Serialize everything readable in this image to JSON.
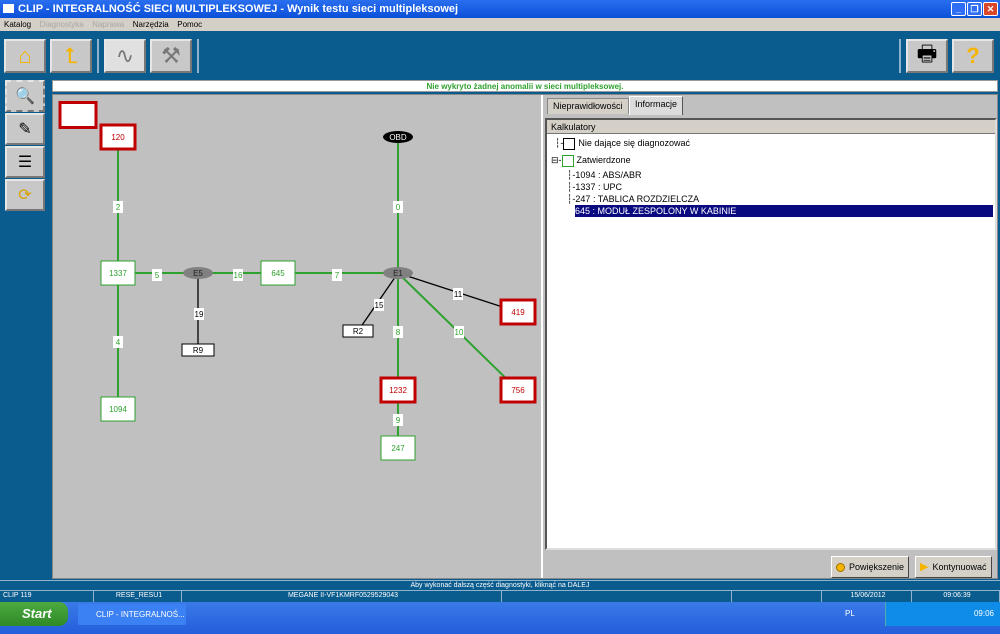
{
  "window": {
    "title": "CLIP - INTEGRALNOŚĆ SIECI MULTIPLEKSOWEJ - Wynik testu sieci multipleksowej"
  },
  "menu": [
    {
      "label": "Katalog",
      "enabled": true
    },
    {
      "label": "Diagnostyka",
      "enabled": false
    },
    {
      "label": "Naprawa",
      "enabled": false
    },
    {
      "label": "Narzędzia",
      "enabled": true
    },
    {
      "label": "Pomoc",
      "enabled": true
    }
  ],
  "toolbar": {
    "icons": [
      "home-icon",
      "back-icon",
      "network-cable-icon",
      "tools-icon",
      "printer-icon",
      "help-icon"
    ]
  },
  "status_message": "Nie wykryto żadnej anomalii w sieci multipleksowej.",
  "colors": {
    "ok": "#2ea12e",
    "error": "#c00000",
    "selected": "#0a0a80",
    "accent": "#0b5c8e"
  },
  "diagram": {
    "nodes": [
      {
        "id": "blank",
        "label": "",
        "status": "error"
      },
      {
        "id": "120",
        "label": "120",
        "status": "error"
      },
      {
        "id": "1337",
        "label": "1337",
        "status": "ok"
      },
      {
        "id": "1094",
        "label": "1094",
        "status": "ok"
      },
      {
        "id": "645",
        "label": "645",
        "status": "ok"
      },
      {
        "id": "OBD",
        "label": "OBD",
        "status": "connector"
      },
      {
        "id": "E5",
        "label": "E5",
        "status": "junction"
      },
      {
        "id": "E1",
        "label": "E1",
        "status": "junction"
      },
      {
        "id": "R9",
        "label": "R9",
        "status": "unknown"
      },
      {
        "id": "R2",
        "label": "R2",
        "status": "unknown"
      },
      {
        "id": "419",
        "label": "419",
        "status": "error"
      },
      {
        "id": "756",
        "label": "756",
        "status": "error"
      },
      {
        "id": "1232",
        "label": "1232",
        "status": "error"
      },
      {
        "id": "247",
        "label": "247",
        "status": "ok"
      }
    ],
    "edges": [
      {
        "from": "120",
        "to": "1337",
        "label": "2",
        "status": "ok"
      },
      {
        "from": "1337",
        "to": "E5",
        "label": "5",
        "status": "ok"
      },
      {
        "from": "E5",
        "to": "645",
        "label": "16",
        "status": "ok"
      },
      {
        "from": "645",
        "to": "E1",
        "label": "7",
        "status": "ok"
      },
      {
        "from": "OBD",
        "to": "E1",
        "label": "0",
        "status": "ok"
      },
      {
        "from": "E5",
        "to": "R9",
        "label": "19",
        "status": "unknown"
      },
      {
        "from": "E1",
        "to": "R2",
        "label": "15",
        "status": "unknown"
      },
      {
        "from": "E1",
        "to": "419",
        "label": "11",
        "status": "unknown"
      },
      {
        "from": "E1",
        "to": "1232",
        "label": "8",
        "status": "ok"
      },
      {
        "from": "E1",
        "to": "756",
        "label": "10",
        "status": "ok"
      },
      {
        "from": "1337",
        "to": "1094",
        "label": "4",
        "status": "ok"
      },
      {
        "from": "1232",
        "to": "247",
        "label": "9",
        "status": "ok"
      }
    ]
  },
  "tabs": [
    {
      "label": "Nieprawidłowości",
      "active": false
    },
    {
      "label": "Informacje",
      "active": true
    }
  ],
  "tree": {
    "header": "Kalkulatory",
    "items": [
      {
        "label": "Nie dające się diagnozować",
        "level": 0
      },
      {
        "label": "Zatwierdzone",
        "level": 0
      },
      {
        "label": "1094 : ABS/ABR",
        "level": 1
      },
      {
        "label": "1337 : UPC",
        "level": 1
      },
      {
        "label": "247 : TABLICA ROZDZIELCZA",
        "level": 1
      },
      {
        "label": "645 : MODUŁ ZESPOLONY W KABINIE",
        "level": 1,
        "selected": true
      }
    ]
  },
  "buttons": {
    "zoom": "Powiększenie",
    "continue": "Kontynuować"
  },
  "footer": {
    "message": "Aby wykonać dalszą część diagnostyki, kliknąć na DALEJ",
    "cells": [
      "CLIP 119",
      "RESE_RESU1",
      "MEGANE II-VF1KMRF0529529043",
      "",
      "",
      "15/06/2012",
      "09:06:39"
    ]
  },
  "taskbar": {
    "start": "Start",
    "task": "CLIP - INTEGRALNOŚ...",
    "lang": "PL",
    "clock": "09:06"
  }
}
